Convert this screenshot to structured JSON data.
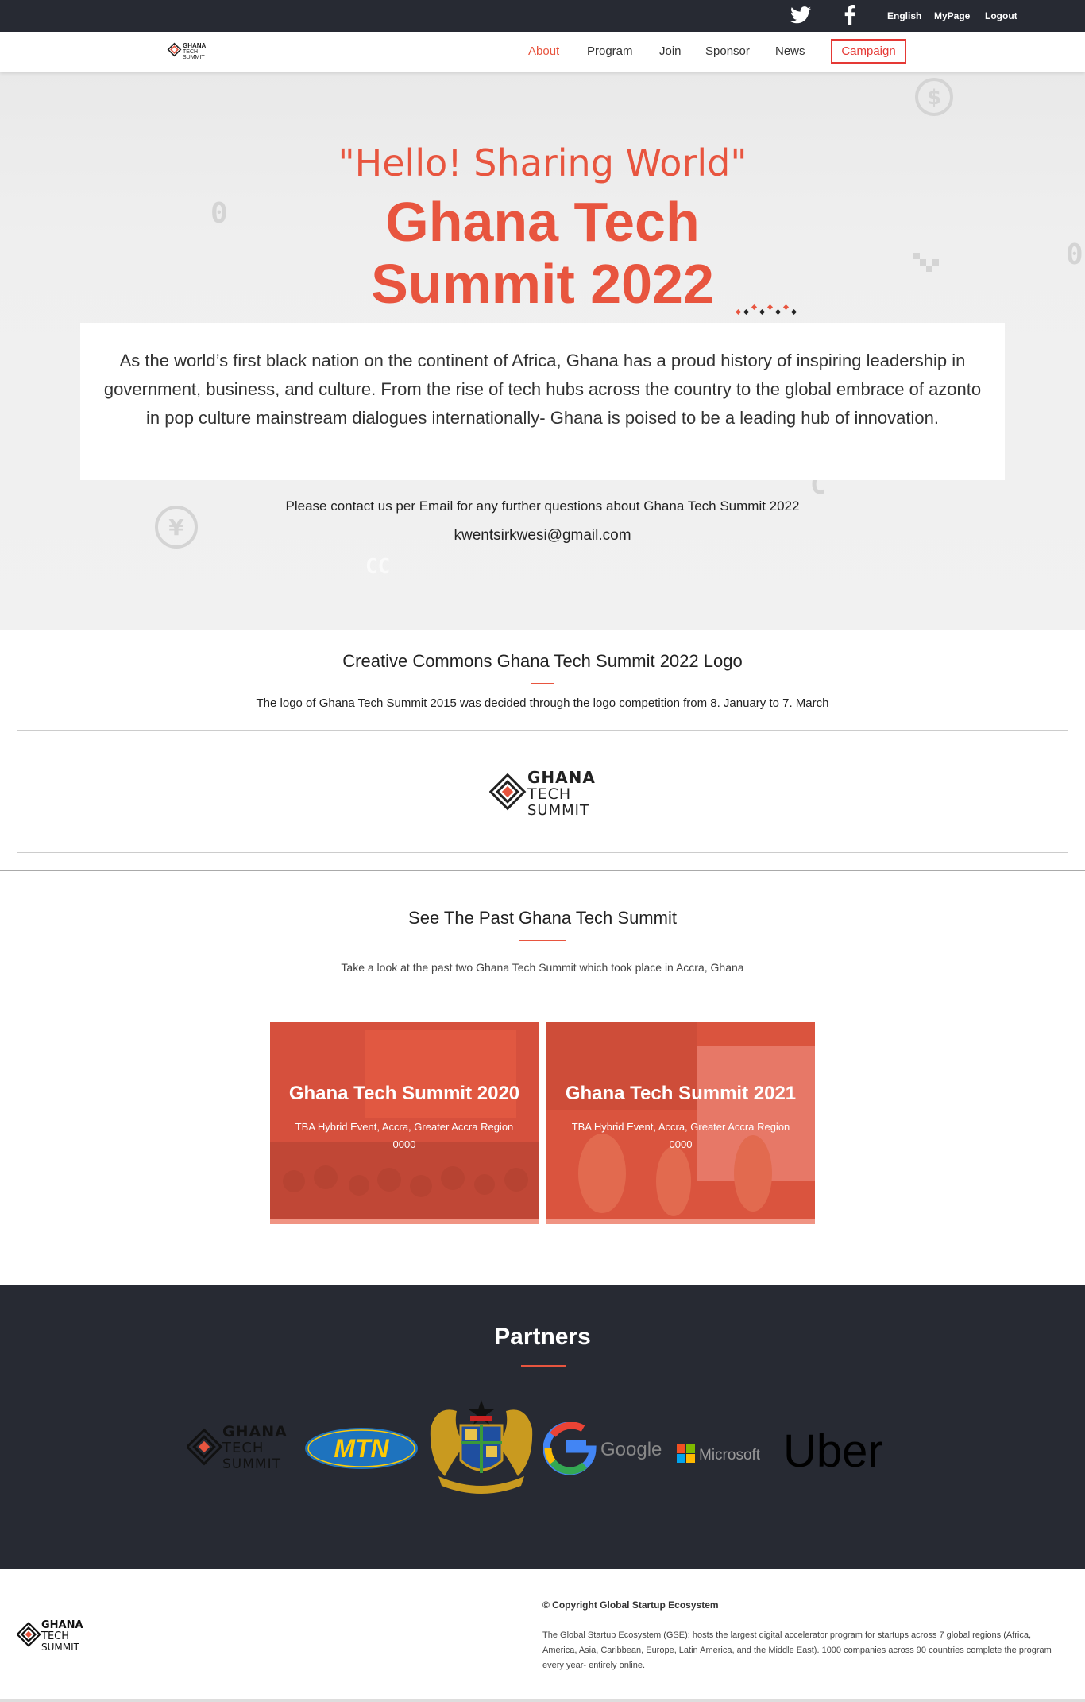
{
  "topbar": {
    "language": "English",
    "mypage": "MyPage",
    "logout": "Logout"
  },
  "nav": {
    "items": [
      "About",
      "Program",
      "Join",
      "Sponsor",
      "News"
    ],
    "campaign": "Campaign",
    "active": "About"
  },
  "logo_text": {
    "line1": "GHANA",
    "line2": "TECH",
    "line3": "SUMMIT"
  },
  "hero": {
    "tagline": "\"Hello! Sharing World\"",
    "title_line1": "Ghana Tech",
    "title_line2": "Summit 2022",
    "intro": "As the world’s first black nation on the continent of Africa, Ghana has a proud history of inspiring leadership in government, business, and culture. From the rise of tech hubs across the country to the global embrace of azonto in pop culture mainstream dialogues internationally- Ghana is poised to be a leading hub of innovation.",
    "contact": "Please contact us per Email for any further questions about Ghana Tech Summit 2022",
    "email": "kwentsirkwesi@gmail.com"
  },
  "cc_logo": {
    "title": "Creative Commons Ghana Tech Summit 2022 Logo",
    "subtitle": "The logo of Ghana Tech Summit 2015 was decided through the logo competition from 8. January to 7. March"
  },
  "past": {
    "title": "See The Past Ghana Tech Summit",
    "subtitle": "Take a look at the past two Ghana Tech Summit which took place in Accra, Ghana",
    "cards": [
      {
        "title": "Ghana Tech Summit 2020",
        "location": "TBA Hybrid Event, Accra, Greater Accra Region",
        "date": "0000"
      },
      {
        "title": "Ghana Tech Summit 2021",
        "location": "TBA Hybrid Event, Accra, Greater Accra Region",
        "date": "0000"
      }
    ]
  },
  "partners": {
    "title": "Partners",
    "logos": [
      "ghana-tech-summit",
      "mtn",
      "ghana-coat-of-arms",
      "google",
      "microsoft",
      "uber"
    ],
    "mtn": "MTN",
    "google": "Google",
    "microsoft": "Microsoft",
    "uber": "Uber"
  },
  "footer": {
    "copyright": "© Copyright Global Startup Ecosystem",
    "description": "The Global Startup Ecosystem (GSE): hosts the largest digital accelerator program for startups across 7 global regions (Africa, America, Asia, Caribbean, Europe, Latin America, and the Middle East). 1000 companies across 90 countries complete the program every year- entirely online."
  },
  "colors": {
    "accent": "#e8553f",
    "dark": "#272a33",
    "campaign_border": "#e53935"
  }
}
